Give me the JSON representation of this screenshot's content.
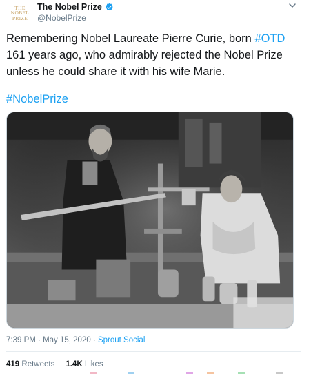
{
  "account": {
    "avatar_lines": [
      "THE",
      "NOBEL",
      "PRIZE"
    ],
    "display_name": "The Nobel Prize",
    "handle": "@NobelPrize",
    "verified": true
  },
  "tweet": {
    "line1_pre": "Remembering Nobel Laureate Pierre Curie, born ",
    "line1_hashtag": "#OTD",
    "line2": "161 years ago, who admirably rejected the Nobel Prize",
    "line3": "unless he could share it with his wife Marie.",
    "hashtag": "#NobelPrize"
  },
  "meta": {
    "time": "7:39 PM",
    "separator1": " · ",
    "date": "May 15, 2020",
    "separator2": " · ",
    "source": "Sprout Social"
  },
  "stats": {
    "retweets_count": "419",
    "retweets_label": "Retweets",
    "likes_count": "1.4K",
    "likes_label": "Likes"
  },
  "icons": {
    "verified": "verified-badge-icon",
    "menu": "chevron-down-icon"
  },
  "colors": {
    "link": "#1da1f2",
    "secondary_text": "#657786",
    "primary_text": "#14171a",
    "avatar_gold": "#c9a66b"
  }
}
